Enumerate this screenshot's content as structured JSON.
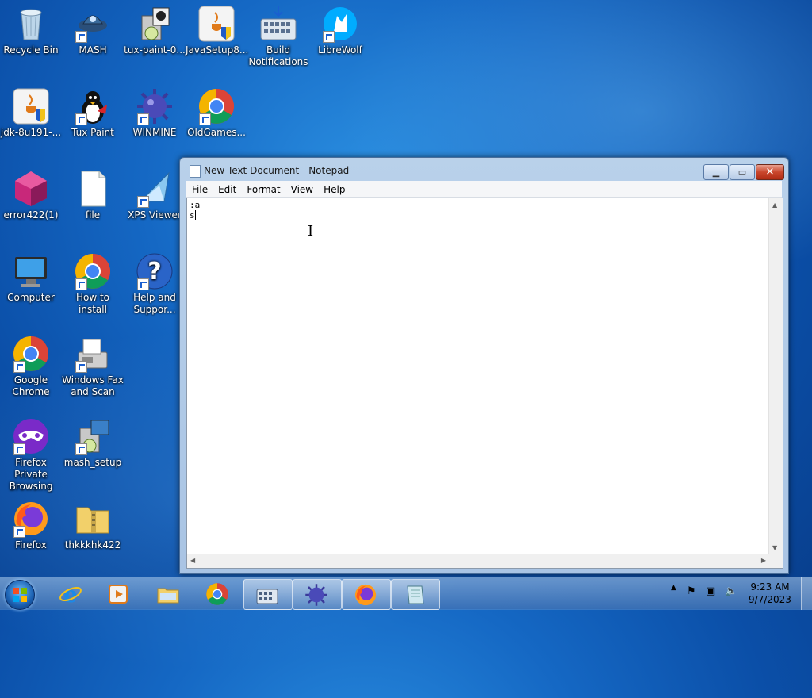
{
  "desktop": {
    "icons": [
      {
        "label": "Recycle Bin"
      },
      {
        "label": "MASH"
      },
      {
        "label": "tux-paint-0..."
      },
      {
        "label": "JavaSetup8..."
      },
      {
        "label": "Build Notifications"
      },
      {
        "label": "LibreWolf"
      },
      {
        "label": "jdk-8u191-..."
      },
      {
        "label": "Tux Paint"
      },
      {
        "label": "WINMINE"
      },
      {
        "label": "OldGames..."
      },
      {
        "label": "error422(1)"
      },
      {
        "label": "file"
      },
      {
        "label": "XPS Viewer"
      },
      {
        "label": "Computer"
      },
      {
        "label": "How to install"
      },
      {
        "label": "Help and Suppor..."
      },
      {
        "label": "Google Chrome"
      },
      {
        "label": "Windows Fax and Scan"
      },
      {
        "label": "Firefox Private Browsing"
      },
      {
        "label": "mash_setup"
      },
      {
        "label": "Firefox"
      },
      {
        "label": "thkkkhk422"
      }
    ]
  },
  "notepad": {
    "title": "New Text Document - Notepad",
    "menu": [
      "File",
      "Edit",
      "Format",
      "View",
      "Help"
    ],
    "content_line1": ":a",
    "content_line2": "s"
  },
  "taskbar": {
    "clock_time": "9:23 AM",
    "clock_date": "9/7/2023"
  },
  "colors": {
    "desktop_blue": "#1568c4",
    "close_red": "#c9462c"
  }
}
